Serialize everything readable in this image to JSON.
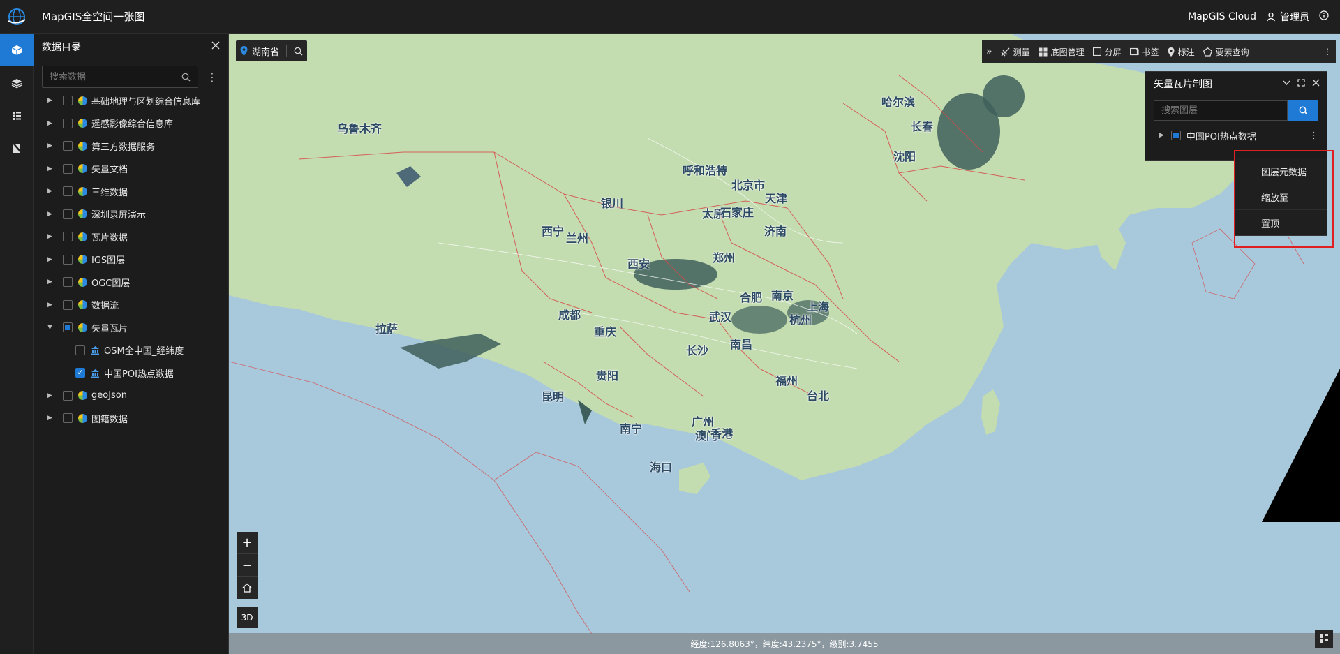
{
  "header": {
    "app_title": "MapGIS全空间一张图",
    "cloud_label": "MapGIS Cloud",
    "user_label": "管理员"
  },
  "catalog": {
    "title": "数据目录",
    "search_placeholder": "搜索数据",
    "items": [
      {
        "label": "基础地理与区划综合信息库",
        "checked": "none",
        "expanded": false
      },
      {
        "label": "遥感影像综合信息库",
        "checked": "none",
        "expanded": false
      },
      {
        "label": "第三方数据服务",
        "checked": "none",
        "expanded": false
      },
      {
        "label": "矢量文档",
        "checked": "none",
        "expanded": false
      },
      {
        "label": "三维数据",
        "checked": "none",
        "expanded": false
      },
      {
        "label": "深圳录屏演示",
        "checked": "none",
        "expanded": false
      },
      {
        "label": "瓦片数据",
        "checked": "none",
        "expanded": false
      },
      {
        "label": "IGS图层",
        "checked": "none",
        "expanded": false
      },
      {
        "label": "OGC图层",
        "checked": "none",
        "expanded": false
      },
      {
        "label": "数据流",
        "checked": "none",
        "expanded": false
      },
      {
        "label": "矢量瓦片",
        "checked": "partial",
        "expanded": true
      },
      {
        "label": "OSM全中国_经纬度",
        "checked": "none",
        "child": true
      },
      {
        "label": "中国POI热点数据",
        "checked": "checked",
        "child": true
      },
      {
        "label": "geoJson",
        "checked": "none",
        "expanded": false
      },
      {
        "label": "图籍数据",
        "checked": "none",
        "expanded": false
      }
    ]
  },
  "location": {
    "region": "湖南省"
  },
  "toolbar": {
    "measure": "测量",
    "basemap": "底图管理",
    "split": "分屏",
    "bookmark": "书签",
    "mark": "标注",
    "query": "要素查询"
  },
  "vector_panel": {
    "title": "矢量瓦片制图",
    "search_placeholder": "搜索图层",
    "layer_name": "中国POI热点数据"
  },
  "context_menu": {
    "item1": "图层元数据",
    "item2": "缩放至",
    "item3": "置顶"
  },
  "map_controls": {
    "zoom_in": "+",
    "zoom_out": "—",
    "mode_3d": "3D"
  },
  "status": {
    "text": "经度:126.8063°，纬度:43.2375°，级别:3.7455"
  },
  "cities": [
    {
      "name": "乌鲁木齐"
    },
    {
      "name": "哈尔滨"
    },
    {
      "name": "长春"
    },
    {
      "name": "沈阳"
    },
    {
      "name": "呼和浩特"
    },
    {
      "name": "北京市"
    },
    {
      "name": "天津"
    },
    {
      "name": "银川"
    },
    {
      "name": "太原"
    },
    {
      "name": "石家庄"
    },
    {
      "name": "西宁"
    },
    {
      "name": "兰州"
    },
    {
      "name": "济南"
    },
    {
      "name": "郑州"
    },
    {
      "name": "西安"
    },
    {
      "name": "合肥"
    },
    {
      "name": "南京"
    },
    {
      "name": "上海"
    },
    {
      "name": "成都"
    },
    {
      "name": "武汉"
    },
    {
      "name": "杭州"
    },
    {
      "name": "拉萨"
    },
    {
      "name": "重庆"
    },
    {
      "name": "长沙"
    },
    {
      "name": "南昌"
    },
    {
      "name": "贵阳"
    },
    {
      "name": "福州"
    },
    {
      "name": "台北"
    },
    {
      "name": "昆明"
    },
    {
      "name": "广州"
    },
    {
      "name": "南宁"
    },
    {
      "name": "澳门"
    },
    {
      "name": "香港"
    },
    {
      "name": "海口"
    }
  ],
  "colors": {
    "accent": "#1f7ad6",
    "land": "#c3dcb0",
    "water": "#a8c8dc",
    "highlight": "#e02020"
  }
}
